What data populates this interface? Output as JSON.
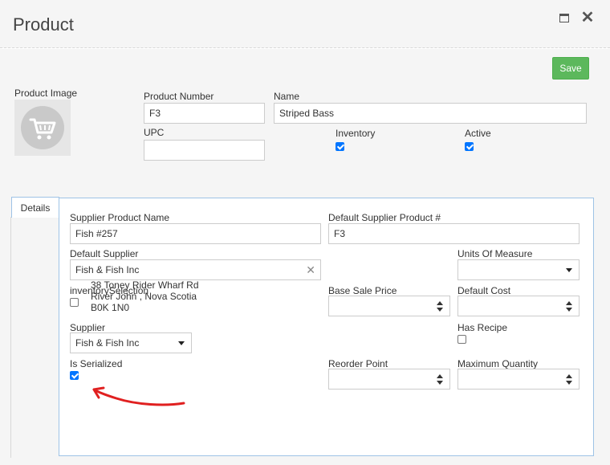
{
  "window": {
    "title": "Product"
  },
  "toolbar": {
    "save_label": "Save"
  },
  "product": {
    "image_label": "Product Image",
    "number_label": "Product Number",
    "number_value": "F3",
    "name_label": "Name",
    "name_value": "Striped Bass",
    "upc_label": "UPC",
    "upc_value": "",
    "inventory_label": "Inventory",
    "inventory_checked": true,
    "active_label": "Active",
    "active_checked": true
  },
  "tabs": [
    {
      "label": "Details"
    }
  ],
  "details": {
    "supplier_product_name_label": "Supplier Product Name",
    "supplier_product_name_value": "Fish #257",
    "default_supplier_product_label": "Default Supplier Product #",
    "default_supplier_product_value": "F3",
    "default_supplier_label": "Default Supplier",
    "default_supplier_value": "Fish & Fish Inc",
    "units_of_measure_label": "Units Of Measure",
    "units_of_measure_value": "",
    "inventory_selection_label": "inventorySelection",
    "address_line1": "38 Toney Rider Wharf Rd",
    "address_line2": "River John , Nova Scotia",
    "address_line3": "B0K 1N0",
    "base_sale_price_label": "Base Sale Price",
    "default_cost_label": "Default Cost",
    "supplier_label": "Supplier",
    "supplier_value": "Fish & Fish Inc",
    "has_recipe_label": "Has Recipe",
    "is_serialized_label": "Is Serialized",
    "reorder_point_label": "Reorder Point",
    "maximum_quantity_label": "Maximum Quantity"
  },
  "colors": {
    "save": "#5cb85c",
    "annotation": "#e02020",
    "tab_border": "#9ec3e6"
  },
  "icons": [
    "maximize-icon",
    "close-icon",
    "cart-icon",
    "clear-icon",
    "chevron-down-icon",
    "spinner-icon"
  ]
}
